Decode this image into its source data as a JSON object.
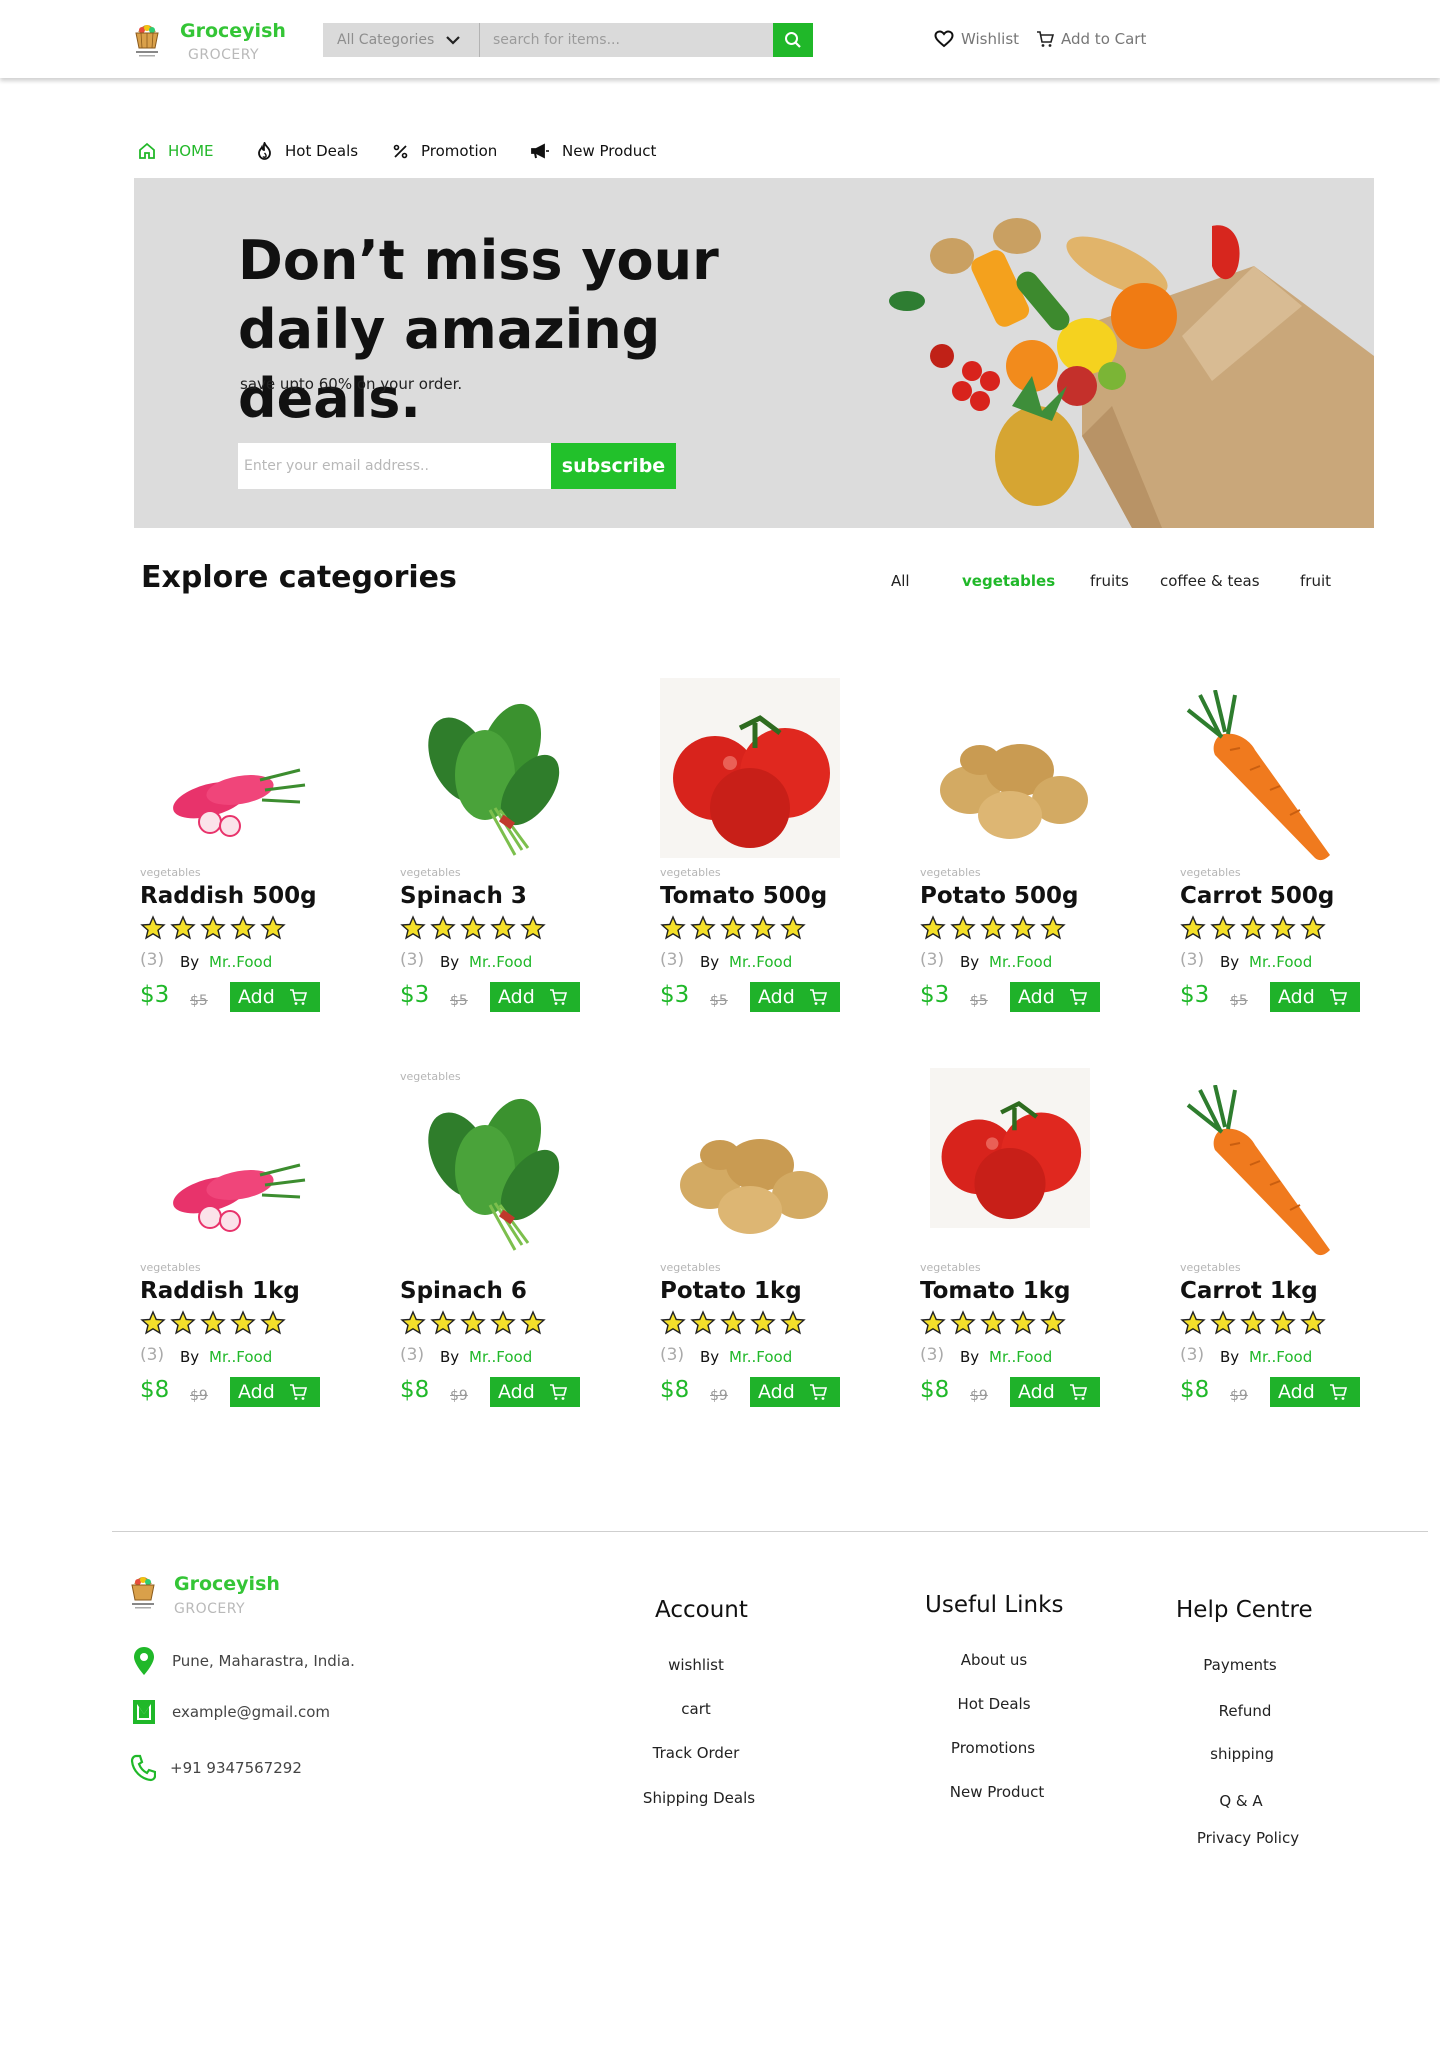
{
  "header": {
    "brand": "Groceyish",
    "brand_sub": "GROCERY",
    "category_select": "All Categories",
    "search_placeholder": "search for items...",
    "wishlist": "Wishlist",
    "cart": "Add to Cart"
  },
  "nav": {
    "items": [
      {
        "label": "HOME",
        "icon": "home-icon"
      },
      {
        "label": "Hot Deals",
        "icon": "flame-icon"
      },
      {
        "label": "Promotion",
        "icon": "percent-icon"
      },
      {
        "label": "New Product",
        "icon": "megaphone-icon"
      }
    ]
  },
  "hero": {
    "title": "Don’t miss your daily amazing deals.",
    "subtitle": "save upto 60% on your order.",
    "email_placeholder": "Enter your email address..",
    "subscribe": "subscribe"
  },
  "categories": {
    "title": "Explore categories",
    "tabs": [
      "All",
      "vegetables",
      "fruits",
      "coffee & teas",
      "fruit"
    ],
    "active_tab": "vegetables"
  },
  "products_row1": [
    {
      "category": "vegetables",
      "name": "Raddish 500g",
      "count": "(3)",
      "by": "By",
      "vendor": "Mr..Food",
      "price": "$3",
      "old_price": "$5",
      "add": "Add"
    },
    {
      "category": "vegetables",
      "name": "Spinach 3",
      "count": "(3)",
      "by": "By",
      "vendor": "Mr..Food",
      "price": "$3",
      "old_price": "$5",
      "add": "Add"
    },
    {
      "category": "vegetables",
      "name": "Tomato 500g",
      "count": "(3)",
      "by": "By",
      "vendor": "Mr..Food",
      "price": "$3",
      "old_price": "$5",
      "add": "Add"
    },
    {
      "category": "vegetables",
      "name": "Potato 500g",
      "count": "(3)",
      "by": "By",
      "vendor": "Mr..Food",
      "price": "$3",
      "old_price": "$5",
      "add": "Add"
    },
    {
      "category": "vegetables",
      "name": "Carrot 500g",
      "count": "(3)",
      "by": "By",
      "vendor": "Mr..Food",
      "price": "$3",
      "old_price": "$5",
      "add": "Add"
    }
  ],
  "products_row2": [
    {
      "category": "vegetables",
      "name": "Raddish 1kg",
      "count": "(3)",
      "by": "By",
      "vendor": "Mr..Food",
      "price": "$8",
      "old_price": "$9",
      "add": "Add"
    },
    {
      "category": "vegetables",
      "name": "Spinach  6",
      "count": "(3)",
      "by": "By",
      "vendor": "Mr..Food",
      "price": "$8",
      "old_price": "$9",
      "add": "Add"
    },
    {
      "category": "vegetables",
      "name": "Potato 1kg",
      "count": "(3)",
      "by": "By",
      "vendor": "Mr..Food",
      "price": "$8",
      "old_price": "$9",
      "add": "Add"
    },
    {
      "category": "vegetables",
      "name": " Tomato 1kg",
      "count": "(3)",
      "by": "By",
      "vendor": "Mr..Food",
      "price": "$8",
      "old_price": "$9",
      "add": "Add"
    },
    {
      "category": "vegetables",
      "name": " Carrot 1kg",
      "count": "(3)",
      "by": "By",
      "vendor": "Mr..Food",
      "price": "$8",
      "old_price": "$9",
      "add": "Add"
    }
  ],
  "footer": {
    "brand": "Groceyish",
    "brand_sub": "GROCERY",
    "address": "Pune, Maharastra, India.",
    "email": "example@gmail.com",
    "phone": "+91 9347567292",
    "account": {
      "title": "Account",
      "links": [
        "wishlist",
        "cart",
        "Track Order",
        "Shipping Deals"
      ]
    },
    "useful": {
      "title": "Useful Links",
      "links": [
        "About us",
        "Hot Deals",
        "Promotions",
        "New Product"
      ]
    },
    "help": {
      "title": "Help Centre",
      "links": [
        "Payments",
        "Refund",
        "shipping",
        "Q & A",
        "Privacy Policy"
      ]
    }
  },
  "colors": {
    "accent": "#20b829",
    "hero_bg": "#dcdcdc",
    "star": "#f5e02a"
  }
}
